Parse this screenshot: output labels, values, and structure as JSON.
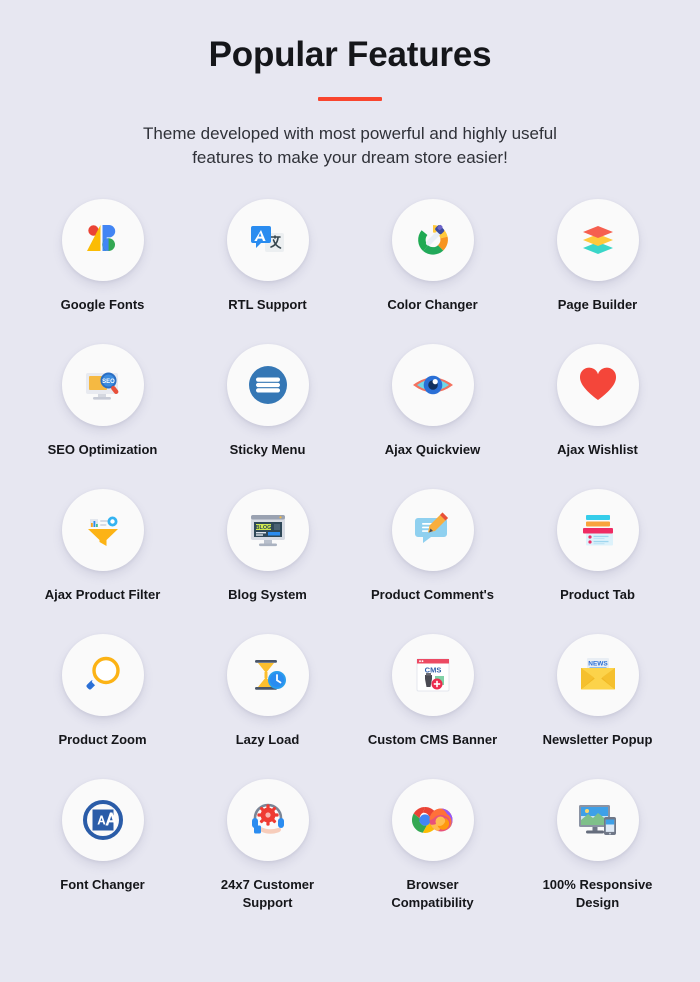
{
  "header": {
    "title": "Popular Features",
    "accent_color": "#f9452e",
    "subtitle_line1": "Theme developed with most powerful and highly useful",
    "subtitle_line2": "features to make your dream store easier!"
  },
  "background_color": "#e7e7f1",
  "features": [
    {
      "label": "Google Fonts",
      "icon": "google-fonts-icon"
    },
    {
      "label": "RTL Support",
      "icon": "translate-icon"
    },
    {
      "label": "Color Changer",
      "icon": "color-picker-icon"
    },
    {
      "label": "Page Builder",
      "icon": "layers-icon"
    },
    {
      "label": "SEO Optimization",
      "icon": "seo-monitor-icon"
    },
    {
      "label": "Sticky Menu",
      "icon": "hamburger-menu-icon"
    },
    {
      "label": "Ajax Quickview",
      "icon": "eye-icon"
    },
    {
      "label": "Ajax Wishlist",
      "icon": "heart-icon"
    },
    {
      "label": "Ajax Product Filter",
      "icon": "funnel-filter-icon"
    },
    {
      "label": "Blog System",
      "icon": "blog-monitor-icon"
    },
    {
      "label": "Product Comment's",
      "icon": "comment-pencil-icon"
    },
    {
      "label": "Product Tab",
      "icon": "tabs-icon"
    },
    {
      "label": "Product Zoom",
      "icon": "magnifier-icon"
    },
    {
      "label": "Lazy Load",
      "icon": "hourglass-clock-icon"
    },
    {
      "label": "Custom CMS Banner",
      "icon": "cms-banner-icon"
    },
    {
      "label": "Newsletter Popup",
      "icon": "newsletter-envelope-icon"
    },
    {
      "label": "Font Changer",
      "icon": "font-size-icon"
    },
    {
      "label": "24x7 Customer Support",
      "icon": "headset-support-icon"
    },
    {
      "label": "Browser Compatibility",
      "icon": "browsers-icon"
    },
    {
      "label": "100% Responsive Design",
      "icon": "responsive-devices-icon"
    }
  ]
}
